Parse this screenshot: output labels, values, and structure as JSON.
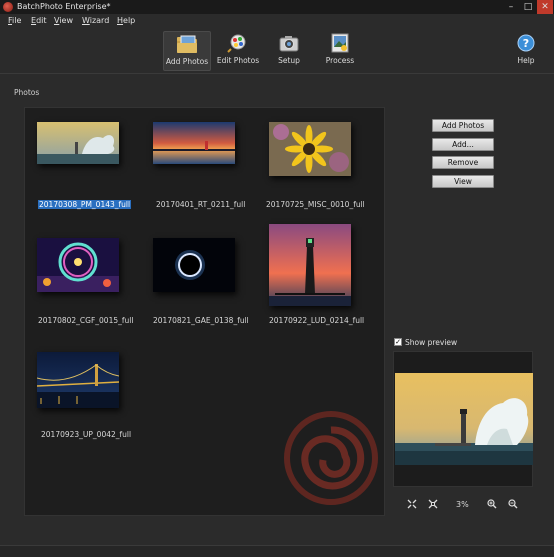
{
  "window": {
    "title": "BatchPhoto Enterprise*"
  },
  "menu": {
    "items": [
      {
        "hotkey": "F",
        "rest": "ile"
      },
      {
        "hotkey": "E",
        "rest": "dit"
      },
      {
        "hotkey": "V",
        "rest": "iew"
      },
      {
        "hotkey": "W",
        "rest": "izard"
      },
      {
        "hotkey": "H",
        "rest": "elp"
      }
    ]
  },
  "toolbar": {
    "add_photos": "Add Photos",
    "edit_photos": "Edit Photos",
    "setup": "Setup",
    "process": "Process",
    "help": "Help",
    "active": "Add Photos"
  },
  "photos_section": {
    "label": "Photos"
  },
  "photos": [
    {
      "name": "20170308_PM_0143_full",
      "selected": true,
      "scene": "wave"
    },
    {
      "name": "20170401_RT_0211_full",
      "selected": false,
      "scene": "sunset"
    },
    {
      "name": "20170725_MISC_0010_full",
      "selected": false,
      "scene": "flower"
    },
    {
      "name": "20170802_CGF_0015_full",
      "selected": false,
      "scene": "wheel"
    },
    {
      "name": "20170821_GAE_0138_full",
      "selected": false,
      "scene": "eclipse"
    },
    {
      "name": "20170922_LUD_0214_full",
      "selected": false,
      "scene": "lighthouse"
    },
    {
      "name": "20170923_UP_0042_full",
      "selected": false,
      "scene": "bridge"
    }
  ],
  "actions": {
    "add_photos": "Add Photos",
    "add_more": "Add...",
    "remove": "Remove",
    "view": "View"
  },
  "preview": {
    "show_label": "Show preview",
    "checked": true,
    "zoom": "3%"
  },
  "icons": {
    "app": "app-logo-icon",
    "add_photos": "folder-photo-icon",
    "edit_photos": "magnifier-palette-icon",
    "setup": "camera-gear-icon",
    "process": "process-image-icon",
    "help": "help-icon",
    "fit": "fit-to-window-icon",
    "actual": "actual-size-icon",
    "zoom_in": "zoom-in-icon",
    "zoom_out": "zoom-out-icon"
  },
  "colors": {
    "background": "#2b2b2b",
    "panel": "#1e1e1e",
    "selection": "#2a6fc0",
    "accent_help": "#3c8fd8"
  }
}
